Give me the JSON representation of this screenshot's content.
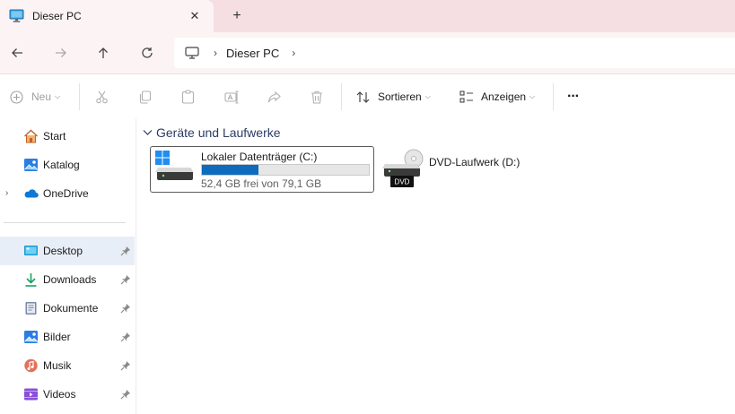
{
  "window": {
    "tab_title": "Dieser PC",
    "tab_close_glyph": "✕",
    "new_tab_glyph": "+"
  },
  "address": {
    "icons": [
      "back-arrow-icon",
      "forward-arrow-icon",
      "up-arrow-icon",
      "refresh-icon",
      "computer-icon"
    ],
    "separator": "›",
    "crumb": "Dieser PC"
  },
  "toolbar": {
    "new_label": "Neu",
    "sort_label": "Sortieren",
    "view_label": "Anzeigen",
    "more_glyph": "···",
    "disabled_icons": [
      "cut-icon",
      "copy-icon",
      "paste-icon",
      "rename-icon",
      "share-icon",
      "delete-icon"
    ]
  },
  "sidebar": {
    "top": [
      {
        "label": "Start",
        "icon": "home-icon"
      },
      {
        "label": "Katalog",
        "icon": "gallery-icon"
      },
      {
        "label": "OneDrive",
        "icon": "cloud-icon",
        "expander": "›"
      }
    ],
    "pinned": [
      {
        "label": "Desktop",
        "icon": "desktop-icon",
        "selected": true
      },
      {
        "label": "Downloads",
        "icon": "download-icon"
      },
      {
        "label": "Dokumente",
        "icon": "document-icon"
      },
      {
        "label": "Bilder",
        "icon": "pictures-icon"
      },
      {
        "label": "Musik",
        "icon": "music-icon"
      },
      {
        "label": "Videos",
        "icon": "videos-icon"
      }
    ]
  },
  "content": {
    "group_label": "Geräte und Laufwerke",
    "drives": [
      {
        "name": "Lokaler Datenträger (C:)",
        "space": "52,4 GB frei von 79,1 GB",
        "used_fraction": 0.338,
        "icon": "windows-drive-icon"
      },
      {
        "name": "DVD-Laufwerk (D:)",
        "icon": "dvd-drive-icon",
        "badge": "DVD"
      }
    ]
  },
  "colors": {
    "accent": "#0f6cbd",
    "tab_strip": "#f5dfe3",
    "selected_bg": "#e8eef7"
  }
}
